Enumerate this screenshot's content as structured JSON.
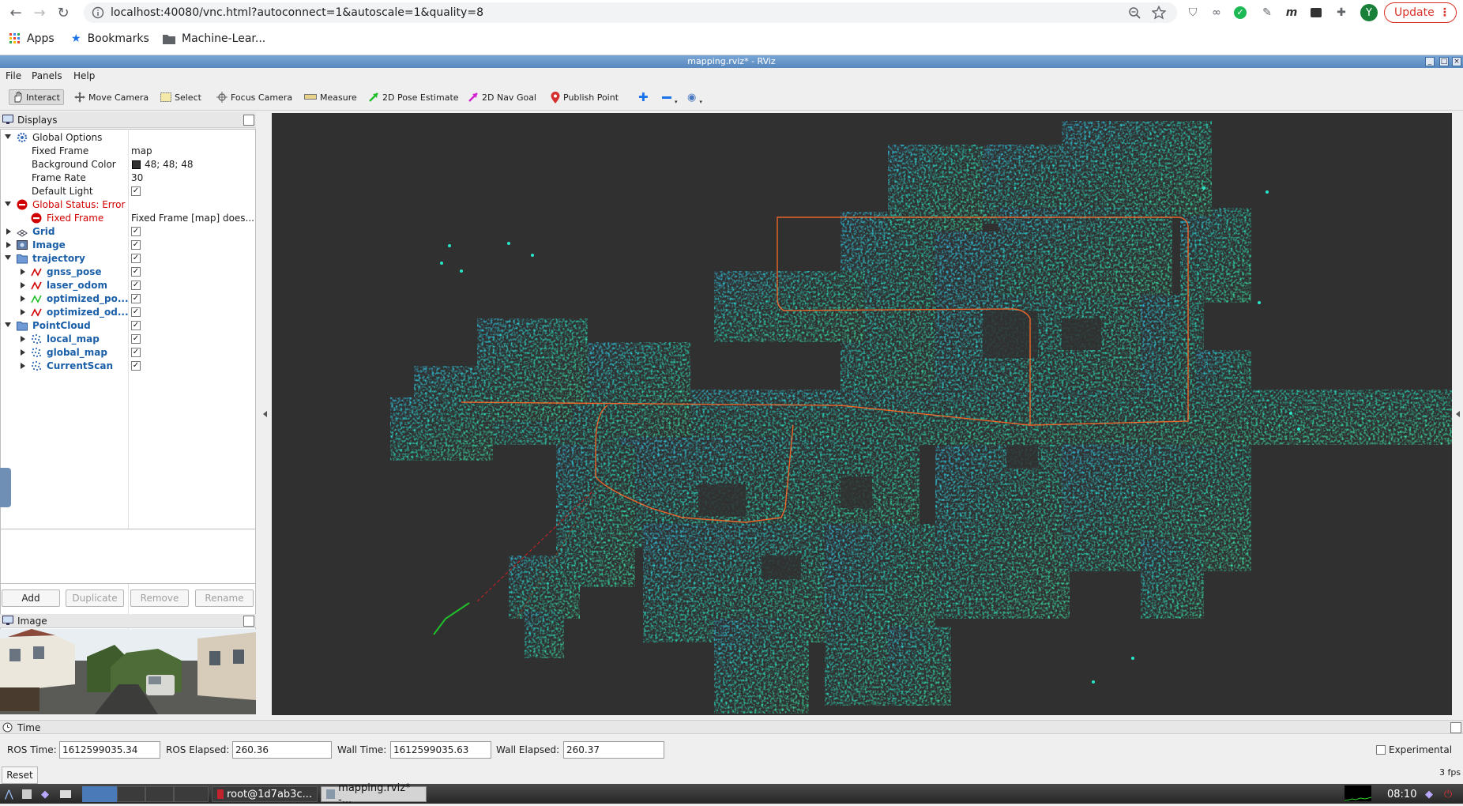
{
  "browser": {
    "url": "localhost:40080/vnc.html?autoconnect=1&autoscale=1&quality=8",
    "bookmarks": [
      {
        "label": "Apps",
        "icon": "apps-grid-icon"
      },
      {
        "label": "Bookmarks",
        "icon": "star-icon"
      },
      {
        "label": "Machine-Lear...",
        "icon": "folder-icon"
      }
    ],
    "avatar_letter": "Y",
    "update_label": "Update",
    "extension_m_label": "m"
  },
  "rviz": {
    "window_title": "mapping.rviz* - RViz",
    "menu": [
      "File",
      "Panels",
      "Help"
    ],
    "tools": [
      {
        "label": "Interact",
        "icon": "hand-icon",
        "active": true
      },
      {
        "label": "Move Camera",
        "icon": "move-camera-icon"
      },
      {
        "label": "Select",
        "icon": "select-icon"
      },
      {
        "label": "Focus Camera",
        "icon": "focus-camera-icon"
      },
      {
        "label": "Measure",
        "icon": "measure-icon"
      },
      {
        "label": "2D Pose Estimate",
        "icon": "pose-estimate-arrow-icon",
        "color": "#1fbf2a"
      },
      {
        "label": "2D Nav Goal",
        "icon": "nav-goal-arrow-icon",
        "color": "#d21fd2"
      },
      {
        "label": "Publish Point",
        "icon": "map-pin-icon",
        "color": "#d62f2f"
      }
    ],
    "displays": {
      "title": "Displays",
      "global_options": {
        "label": "Global Options",
        "fixed_frame_label": "Fixed Frame",
        "fixed_frame_value": "map",
        "background_color_label": "Background Color",
        "background_color_value": "48; 48; 48",
        "background_color_hex": "#303030",
        "frame_rate_label": "Frame Rate",
        "frame_rate_value": "30",
        "default_light_label": "Default Light"
      },
      "global_status": {
        "label": "Global Status: Error",
        "fixed_frame_label": "Fixed Frame",
        "fixed_frame_value": "Fixed Frame [map] does..."
      },
      "items": {
        "grid": "Grid",
        "image": "Image",
        "trajectory": "trajectory",
        "gnss_pose": "gnss_pose",
        "laser_odom": "laser_odom",
        "optimized_pose": "optimized_po...",
        "optimized_odom": "optimized_od...",
        "pointcloud": "PointCloud",
        "local_map": "local_map",
        "global_map": "global_map",
        "current_scan": "CurrentScan"
      },
      "buttons": {
        "add": "Add",
        "duplicate": "Duplicate",
        "remove": "Remove",
        "rename": "Rename"
      }
    },
    "image_panel_title": "Image",
    "time": {
      "title": "Time",
      "ros_time_label": "ROS Time:",
      "ros_time_value": "1612599035.34",
      "ros_elapsed_label": "ROS Elapsed:",
      "ros_elapsed_value": "260.36",
      "wall_time_label": "Wall Time:",
      "wall_time_value": "1612599035.63",
      "wall_elapsed_label": "Wall Elapsed:",
      "wall_elapsed_value": "260.37",
      "experimental_label": "Experimental",
      "reset_label": "Reset",
      "fps": "3 fps"
    }
  },
  "taskbar": {
    "tasks": [
      "root@1d7ab3c...",
      "mapping.rviz* -..."
    ],
    "clock": "08:10"
  },
  "colors": {
    "view_background": "#303030",
    "point_cyan": "#27e6c8",
    "point_blue": "#1fa0ff",
    "status_error": "#d00000",
    "display_name_blue": "#1a5fa8"
  }
}
